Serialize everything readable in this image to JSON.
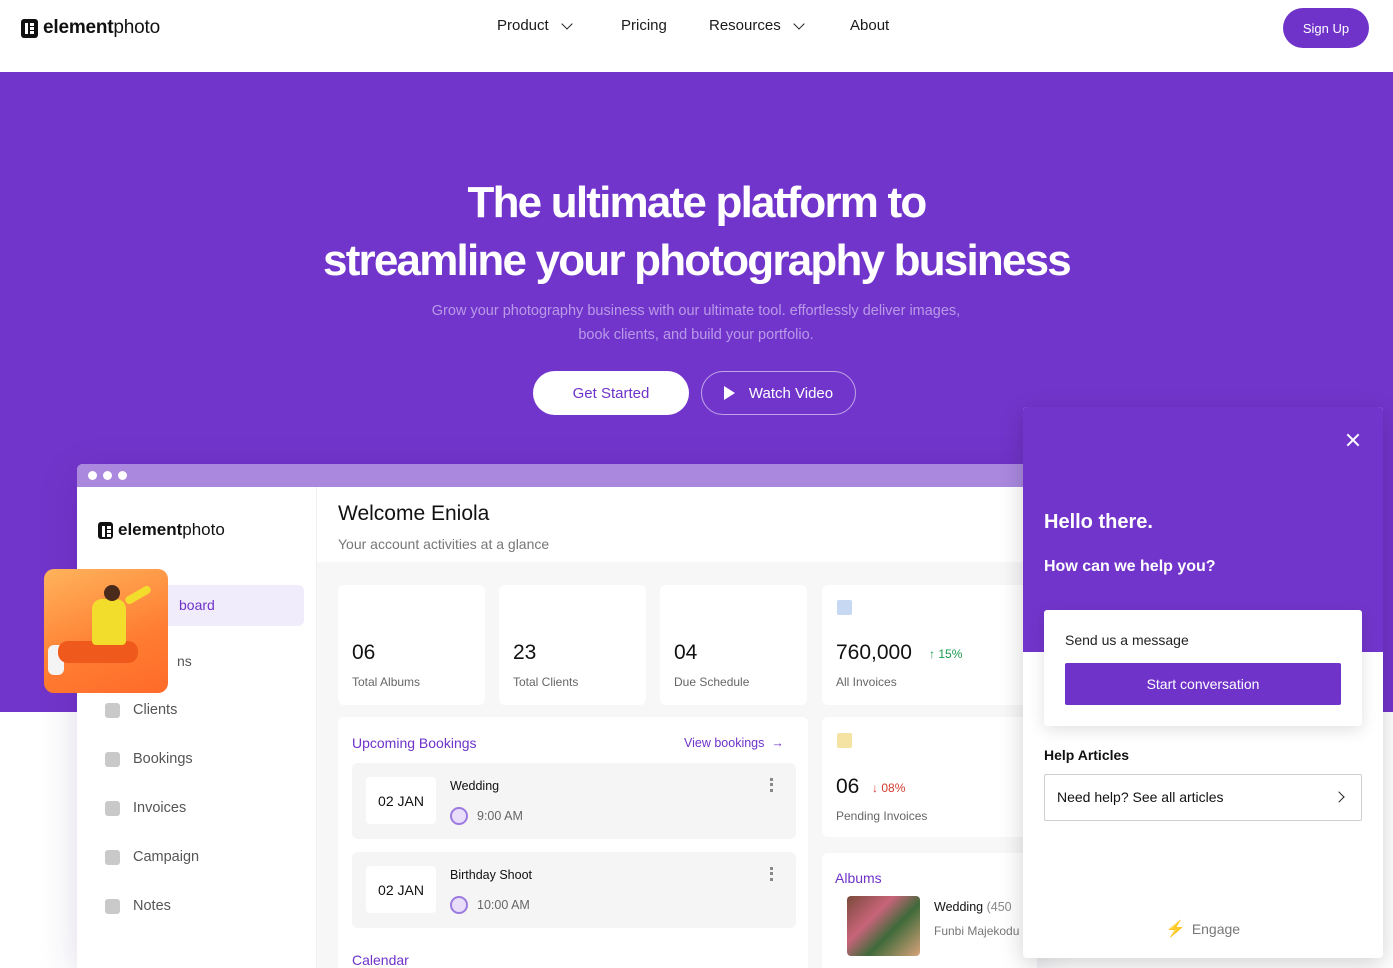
{
  "nav": {
    "logo_bold": "element",
    "logo_light": "photo",
    "links": [
      {
        "label": "Product",
        "has_chevron": true
      },
      {
        "label": "Pricing",
        "has_chevron": false
      },
      {
        "label": "Resources",
        "has_chevron": true
      },
      {
        "label": "About",
        "has_chevron": false
      }
    ],
    "signup_label": "Sign Up"
  },
  "hero": {
    "title_line1": "The ultimate platform to",
    "title_line2": "streamline your photography business",
    "subtitle_line1": "Grow your photography business with our ultimate tool. effortlessly deliver images,",
    "subtitle_line2": "book clients, and build your portfolio.",
    "cta_primary": "Get Started",
    "cta_secondary": "Watch Video"
  },
  "dashboard": {
    "logo_bold": "element",
    "logo_light": "photo",
    "sidebar": {
      "active_partial": "board",
      "partial_second": "ns",
      "items": [
        {
          "label": "Clients",
          "icon": "clients-icon"
        },
        {
          "label": "Bookings",
          "icon": "calendar-icon"
        },
        {
          "label": "Invoices",
          "icon": "invoice-icon"
        },
        {
          "label": "Campaign",
          "icon": "megaphone-icon"
        },
        {
          "label": "Notes",
          "icon": "notes-icon"
        }
      ]
    },
    "welcome_title": "Welcome Eniola",
    "welcome_sub": "Your account activities at a glance",
    "stats": [
      {
        "value": "06",
        "label": "Total Albums"
      },
      {
        "value": "23",
        "label": "Total Clients"
      },
      {
        "value": "04",
        "label": "Due Schedule"
      },
      {
        "value": "760,000",
        "label": "All Invoices",
        "change": "15%",
        "direction": "up"
      }
    ],
    "pending": {
      "value": "06",
      "label": "Pending Invoices",
      "change": "08%",
      "direction": "down"
    },
    "bookings": {
      "title": "Upcoming Bookings",
      "view_label": "View bookings",
      "items": [
        {
          "date": "02 JAN",
          "name": "Wedding",
          "time": "9:00 AM"
        },
        {
          "date": "02 JAN",
          "name": "Birthday Shoot",
          "time": "10:00 AM"
        }
      ]
    },
    "calendar_label": "Calendar",
    "albums": {
      "title": "Albums",
      "item_name": "Wedding",
      "item_count": "(450",
      "item_owner": "Funbi Majekodu"
    }
  },
  "chat": {
    "hello": "Hello there.",
    "help": "How can we help you?",
    "message_label": "Send us a message",
    "start_label": "Start conversation",
    "articles_title": "Help Articles",
    "article_link": "Need help? See all articles",
    "footer": "Engage"
  },
  "colors": {
    "brand": "#7235cb",
    "button": "#6f33c9",
    "up": "#1a9a4e",
    "down": "#d23a2f"
  }
}
